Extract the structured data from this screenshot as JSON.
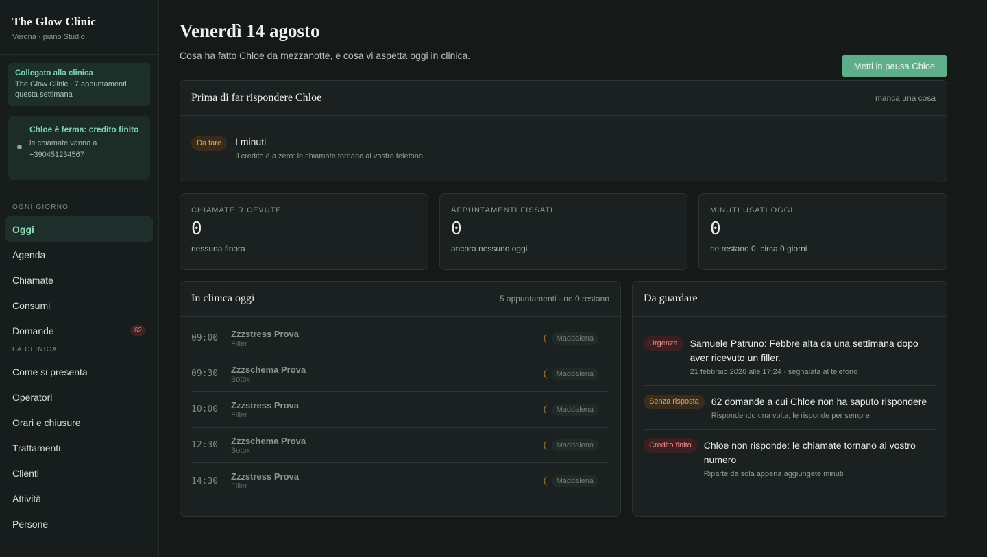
{
  "sidebar": {
    "brand_title": "The Glow Clinic",
    "brand_sub": "Verona · piano Studio",
    "connected_title": "Collegato alla clinica",
    "connected_sub": "The Glow Clinic · 7 appuntamenti questa settimana",
    "status_title": "Chloe è ferma: credito finito",
    "status_sub": "le chiamate vanno a +390451234567",
    "section_daily": "OGNI GIORNO",
    "daily_items": [
      {
        "label": "Oggi",
        "active": true
      },
      {
        "label": "Agenda"
      },
      {
        "label": "Chiamate"
      },
      {
        "label": "Consumi"
      },
      {
        "label": "Domande",
        "badge": "62"
      }
    ],
    "section_clinic": "LA CLINICA",
    "clinic_items": [
      {
        "label": "Come si presenta"
      },
      {
        "label": "Operatori"
      },
      {
        "label": "Orari e chiusure"
      },
      {
        "label": "Trattamenti"
      },
      {
        "label": "Clienti"
      },
      {
        "label": "Attività"
      },
      {
        "label": "Persone"
      }
    ]
  },
  "header": {
    "title": "Venerdì 14 agosto",
    "subtitle": "Cosa ha fatto Chloe da mezzanotte, e cosa vi aspetta oggi in clinica.",
    "pause_button": "Metti in pausa Chloe"
  },
  "before": {
    "title": "Prima di far rispondere Chloe",
    "meta": "manca una cosa",
    "item": {
      "tag": "Da fare",
      "title": "I minuti",
      "desc": "Il credito è a zero: le chiamate tornano al vostro telefono."
    }
  },
  "stats": [
    {
      "label": "CHIAMATE RICEVUTE",
      "value": "0",
      "foot": "nessuna finora"
    },
    {
      "label": "APPUNTAMENTI FISSATI",
      "value": "0",
      "foot": "ancora nessuno oggi"
    },
    {
      "label": "MINUTI USATI OGGI",
      "value": "0",
      "foot": "ne restano 0, circa 0 giorni"
    }
  ],
  "today": {
    "title": "In clinica oggi",
    "meta": "5 appuntamenti · ne 0 restano",
    "appointments": [
      {
        "time": "09:00",
        "client": "Zzzstress Prova",
        "treatment": "Filler",
        "staff": "Maddalena"
      },
      {
        "time": "09:30",
        "client": "Zzzschema Prova",
        "treatment": "Botox",
        "staff": "Maddalena"
      },
      {
        "time": "10:00",
        "client": "Zzzstress Prova",
        "treatment": "Filler",
        "staff": "Maddalena"
      },
      {
        "time": "12:30",
        "client": "Zzzschema Prova",
        "treatment": "Botox",
        "staff": "Maddalena"
      },
      {
        "time": "14:30",
        "client": "Zzzstress Prova",
        "treatment": "Filler",
        "staff": "Maddalena"
      }
    ]
  },
  "watch": {
    "title": "Da guardare",
    "items": [
      {
        "tag": "Urgenza",
        "tone": "red",
        "title": "Samuele Patruno: Febbre alta da una settimana dopo aver ricevuto un filler.",
        "desc": "21 febbraio 2026 alle 17:24 · segnalata al telefono"
      },
      {
        "tag": "Senza risposta",
        "tone": "amber",
        "title": "62 domande a cui Chloe non ha saputo rispondere",
        "desc": "Rispondendo una volta, le risponde per sempre"
      },
      {
        "tag": "Credito finito",
        "tone": "red",
        "title": "Chloe non risponde: le chiamate tornano al vostro numero",
        "desc": "Riparte da sola appena aggiungete minuti"
      }
    ]
  },
  "colors": {
    "accent": "#5fae8a",
    "background": "#151a19",
    "panel": "#1a2120",
    "urgent": "#e88c87",
    "warning": "#e2a55a"
  }
}
